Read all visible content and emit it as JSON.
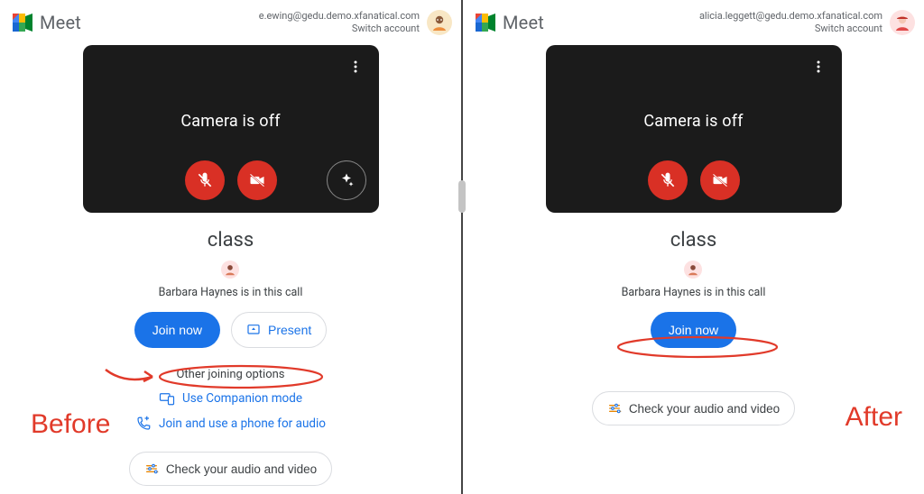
{
  "left": {
    "product": "Meet",
    "account_email": "e.ewing@gedu.demo.xfanatical.com",
    "switch_account": "Switch account",
    "camera_off": "Camera is off",
    "meeting_title": "class",
    "participant_line": "Barbara Haynes is in this call",
    "join_label": "Join now",
    "present_label": "Present",
    "other_options_label": "Other joining options",
    "companion_label": "Use Companion mode",
    "phone_label": "Join and use a phone for audio",
    "check_av_label": "Check your audio and video",
    "annotation": "Before"
  },
  "right": {
    "product": "Meet",
    "account_email": "alicia.leggett@gedu.demo.xfanatical.com",
    "switch_account": "Switch account",
    "camera_off": "Camera is off",
    "meeting_title": "class",
    "participant_line": "Barbara Haynes is in this call",
    "join_label": "Join now",
    "check_av_label": "Check your audio and video",
    "annotation": "After"
  }
}
